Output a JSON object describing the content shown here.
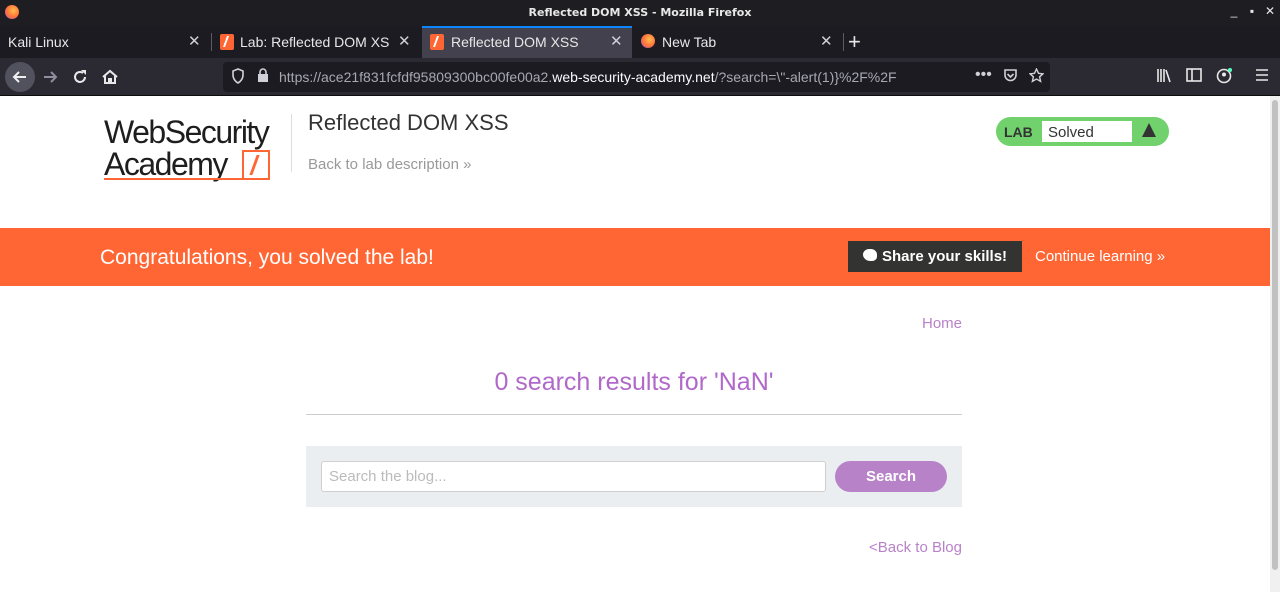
{
  "window": {
    "title": "Reflected DOM XSS - Mozilla Firefox",
    "controls": [
      "_",
      "▪",
      "✕"
    ]
  },
  "tabs": [
    {
      "label": "Kali Linux",
      "close": "✕"
    },
    {
      "label": "Lab: Reflected DOM XSS",
      "close": "✕"
    },
    {
      "label": "Reflected DOM XSS",
      "close": "✕",
      "active": true
    },
    {
      "label": "New Tab",
      "close": "✕"
    }
  ],
  "newtab_label": "+",
  "urlbar": {
    "prefix": "https://ace21f831fcfdf95809300bc00fe00a2.",
    "host": "web-security-academy.net",
    "suffix": "/?search=\\\"-alert(1)}%2F%2F"
  },
  "logo": {
    "line1": "WebSecurity",
    "line2": "Academy"
  },
  "header": {
    "lab_title": "Reflected DOM XSS",
    "back_description": "Back to lab description »"
  },
  "lab_badge": {
    "tag": "LAB",
    "status": "Solved"
  },
  "banner": {
    "message": "Congratulations, you solved the lab!",
    "share_label": "Share your skills!",
    "continue_label": "Continue learning »"
  },
  "nav": {
    "home": "Home"
  },
  "results": {
    "heading": "0 search results for 'NaN'"
  },
  "search": {
    "placeholder": "Search the blog...",
    "button": "Search"
  },
  "footer": {
    "back_to_blog": "<Back to Blog"
  },
  "colors": {
    "accent": "#ff6633",
    "purple": "#b882c9",
    "lab_green": "#70d16d"
  }
}
